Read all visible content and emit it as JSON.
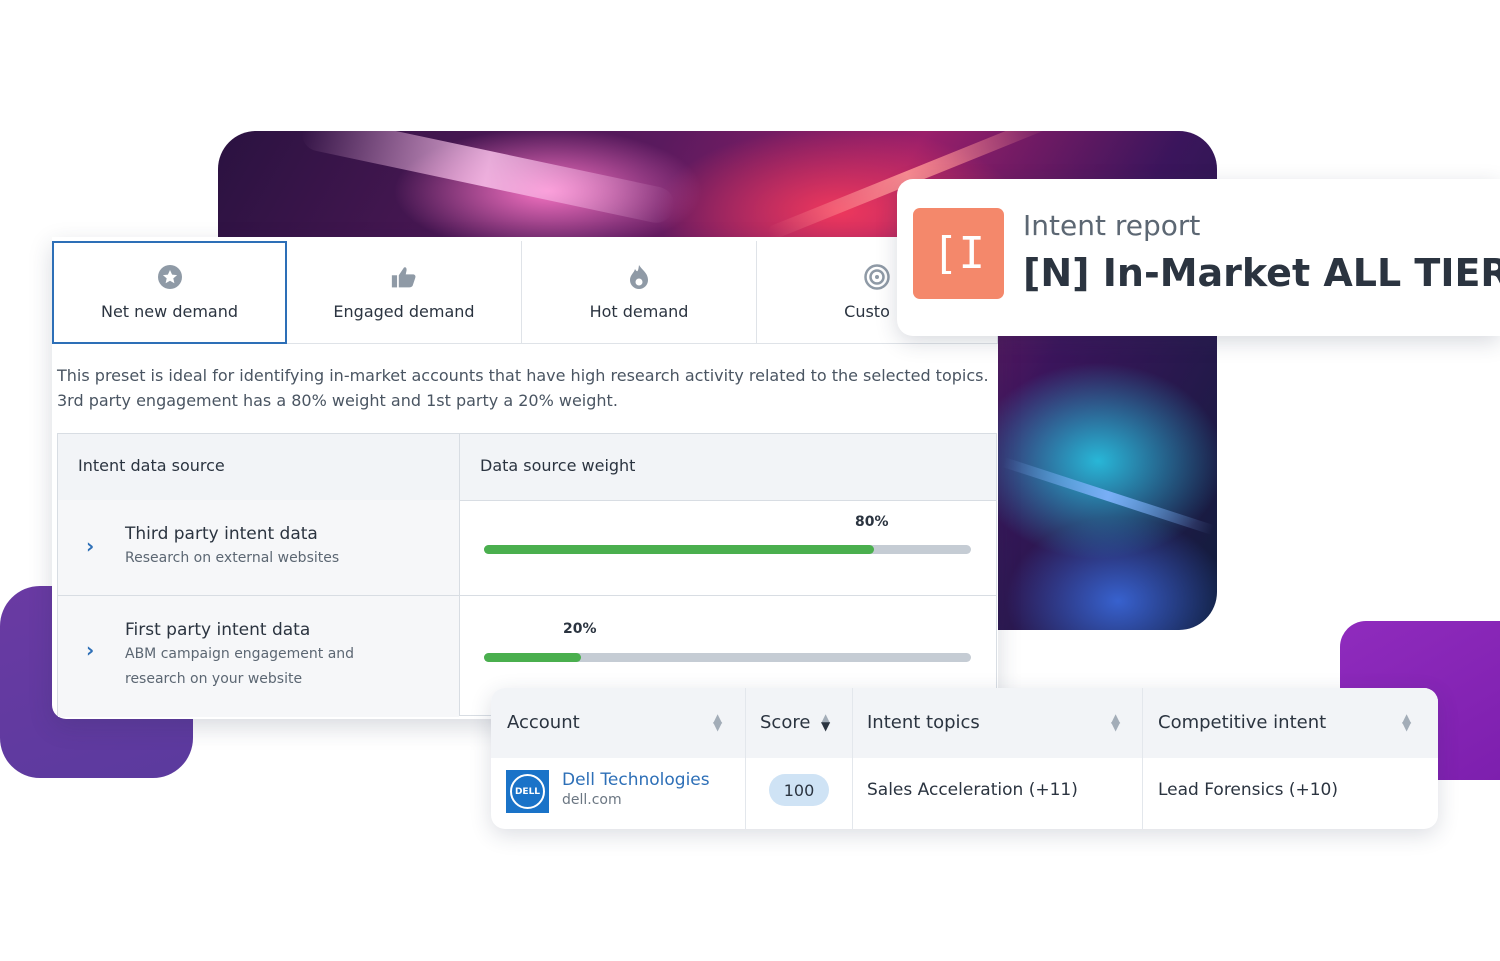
{
  "tabs": [
    {
      "label": "Net new demand",
      "icon": "star-icon",
      "active": true
    },
    {
      "label": "Engaged demand",
      "icon": "thumbs-up-icon",
      "active": false
    },
    {
      "label": "Hot demand",
      "icon": "flame-icon",
      "active": false
    },
    {
      "label": "Custo",
      "icon": "target-icon",
      "active": false
    }
  ],
  "preset_description": "This preset is ideal for identifying in-market accounts that have high research activity related to the selected topics. 3rd party engagement has a 80% weight and 1st party a 20% weight.",
  "sources_table": {
    "headers": [
      "Intent data source",
      "Data source weight"
    ],
    "rows": [
      {
        "title": "Third party intent data",
        "subtitle": "Research on external websites",
        "weight_label": "80%",
        "weight": 0.8
      },
      {
        "title": "First party intent data",
        "subtitle": "ABM campaign engagement and research on your website",
        "weight_label": "20%",
        "weight": 0.2
      }
    ]
  },
  "report": {
    "logo_text": "[I",
    "subtitle": "Intent report",
    "title": "[N] In-Market ALL TIERS"
  },
  "accounts_table": {
    "headers": [
      "Account",
      "Score",
      "Intent topics",
      "Competitive intent"
    ],
    "rows": [
      {
        "name": "Dell Technologies",
        "domain": "dell.com",
        "logo_text": "DELL",
        "score": "100",
        "intent_topics": "Sales Acceleration (+11)",
        "competitive_intent": "Lead Forensics (+10)"
      }
    ]
  },
  "colors": {
    "accent": "#2d6fb7",
    "progress": "#4aaf4e",
    "report_logo": "#f4886b",
    "purple": "#7d1fae"
  }
}
